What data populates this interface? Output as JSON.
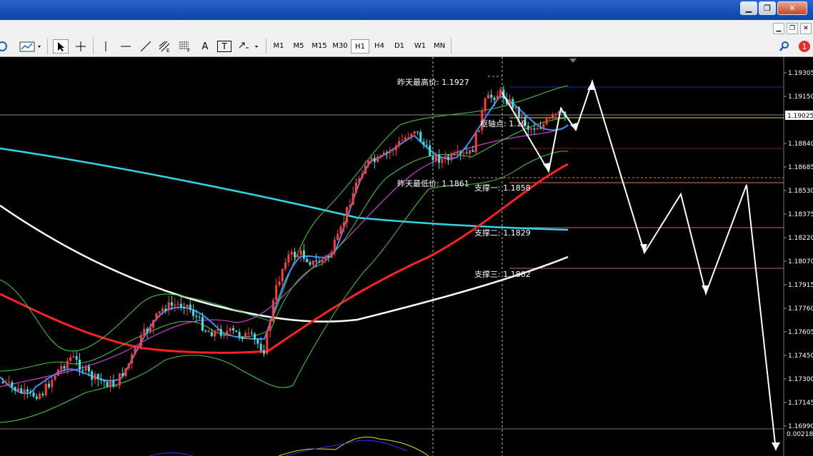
{
  "window": {
    "minimize": "▁",
    "restore": "❐",
    "close": "✕"
  },
  "mdi": {
    "minimize": "▁",
    "restore": "❐",
    "close": "✕"
  },
  "toolbar": {
    "text_tool": "A",
    "label_tool": "T",
    "timeframes": [
      "M1",
      "M5",
      "M15",
      "M30",
      "H1",
      "H4",
      "D1",
      "W1",
      "MN"
    ],
    "active_timeframe": "H1"
  },
  "notification_count": "1",
  "current_price": "1.19025",
  "annotations": {
    "prev_high": "昨天最高价: 1.1927",
    "prev_low": "昨天最低价: 1.1861",
    "pivot": "枢轴点: 1.19",
    "support1": "支撑一: 1.1858",
    "support2": "支撑二: 1.1829",
    "support3": "支撑三: 1.1802"
  },
  "chart_data": {
    "type": "candlestick",
    "symbol_ticks": [
      "1.19305",
      "1.19150",
      "1.19025",
      "1.18840",
      "1.18685",
      "1.18530",
      "1.18375",
      "1.18220",
      "1.18070",
      "1.17915",
      "1.17760",
      "1.17605",
      "1.17450",
      "1.17300",
      "1.17145",
      "1.16990"
    ],
    "levels": {
      "prev_high": 1.1927,
      "pivot": 1.19,
      "prev_low": 1.1861,
      "support1": 1.1858,
      "support2": 1.1829,
      "support3": 1.1802
    },
    "forecast_path_prices": [
      1.19,
      1.1893,
      1.1923,
      1.1813,
      1.1853,
      1.1783,
      1.1859,
      1.1665
    ],
    "indicator_value": "0.002184",
    "colors": {
      "bull": "#ff3b3b",
      "bear": "#40e0e0",
      "ma_red": "#ff2020",
      "ma_white": "#ffffff",
      "ma_cyan": "#30d8e8",
      "ma_blue": "#3d8fff",
      "ma_magenta": "#d040d0",
      "bollinger": "#40d040"
    }
  }
}
